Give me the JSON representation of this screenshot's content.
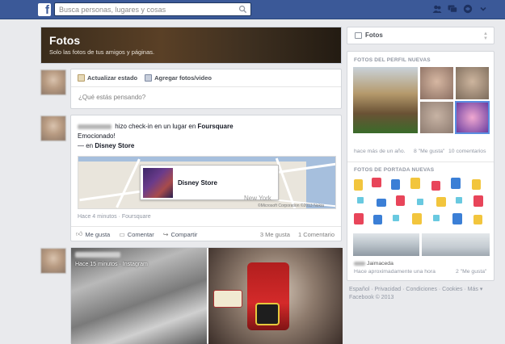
{
  "topbar": {
    "logo": "f",
    "search_placeholder": "Busca personas, lugares y cosas",
    "icons": [
      "friend-requests-icon",
      "messages-icon",
      "notifications-icon",
      "dropdown-icon"
    ]
  },
  "banner": {
    "title": "Fotos",
    "subtitle": "Solo las fotos de tus amigos y páginas."
  },
  "composer": {
    "tab_status": "Actualizar estado",
    "tab_photo": "Agregar fotos/video",
    "placeholder": "¿Qué estás pensando?"
  },
  "post1": {
    "action_text": "hizo check-in en un lugar en",
    "app_name": "Foursquare",
    "line2": "Emocionado!",
    "at_prefix": "— en",
    "place": "Disney Store",
    "map_place_label": "Disney Store",
    "map_label_city": "New York",
    "map_copyright": "©Microsoft Corporation ©2013 Nokia",
    "time": "Hace 4 minutos · Foursquare",
    "like": "Me gusta",
    "comment": "Comentar",
    "share": "Compartir",
    "likes_count": "3 Me gusta",
    "comments_count": "1 Comentario"
  },
  "post2": {
    "time": "Hace 15 minutos · Instagram"
  },
  "right": {
    "header_title": "Fotos",
    "section1_title": "FOTOS DEL PERFIL NUEVAS",
    "section1_time": "hace más de un año.",
    "section1_likes": "8 \"Me gusta\"",
    "section1_comments": "10 comentarios",
    "section2_title": "FOTOS DE PORTADA NUEVAS",
    "section2_name_suffix": "Jaimaceda",
    "section2_time": "Hace aproximadamente una hora",
    "section2_likes": "2 \"Me gusta\""
  },
  "footer": {
    "links": "Español · Privacidad · Condiciones · Cookies · Más ▾",
    "copyright": "Facebook © 2013"
  },
  "colors": {
    "brand": "#3b5998",
    "background": "#e9eaed"
  }
}
